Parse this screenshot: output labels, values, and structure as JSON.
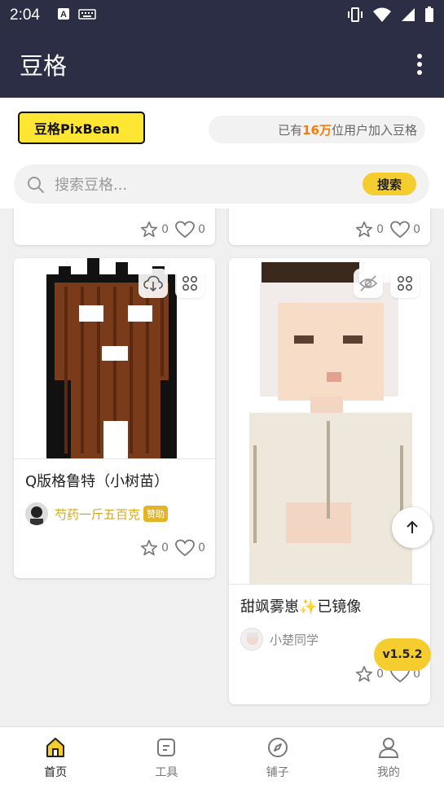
{
  "status_bar": {
    "time": "2:04",
    "icons": [
      "a-icon",
      "keyboard-icon",
      "vibrate-icon",
      "wifi-icon",
      "signal-icon",
      "battery-icon"
    ]
  },
  "app_bar": {
    "title": "豆格",
    "menu_icon": "more-vert-icon"
  },
  "header": {
    "logo_text": "豆格PixBean",
    "user_count": {
      "prefix": "已有",
      "count": "16万",
      "suffix": "位用户加入豆格"
    }
  },
  "search": {
    "placeholder": "搜索豆格...",
    "button_label": "搜索"
  },
  "feed": {
    "top_cards": [
      {
        "stars": "0",
        "likes": "0"
      },
      {
        "stars": "0",
        "likes": "0"
      }
    ],
    "cards": [
      {
        "title": "Q版格鲁特（小树苗）",
        "author": "芍药一斤五百克",
        "badge": "赞助",
        "stars": "0",
        "likes": "0",
        "action_icon": "cloud-download-icon"
      },
      {
        "title": "甜飒雾崽✨已镜像",
        "author": "小楚同学",
        "stars": "0",
        "likes": "0",
        "action_icon": "eye-off-icon"
      }
    ]
  },
  "version_label": "v1.5.2",
  "bottom_nav": [
    {
      "label": "首页",
      "icon": "home-icon",
      "active": true
    },
    {
      "label": "工具",
      "icon": "tools-icon",
      "active": false
    },
    {
      "label": "铺子",
      "icon": "compass-icon",
      "active": false
    },
    {
      "label": "我的",
      "icon": "user-icon",
      "active": false
    }
  ],
  "colors": {
    "app_bar_bg": "#2b2e45",
    "accent": "#f6cd2e",
    "highlight_orange": "#ff7a00",
    "author_gold": "#d9a615"
  }
}
